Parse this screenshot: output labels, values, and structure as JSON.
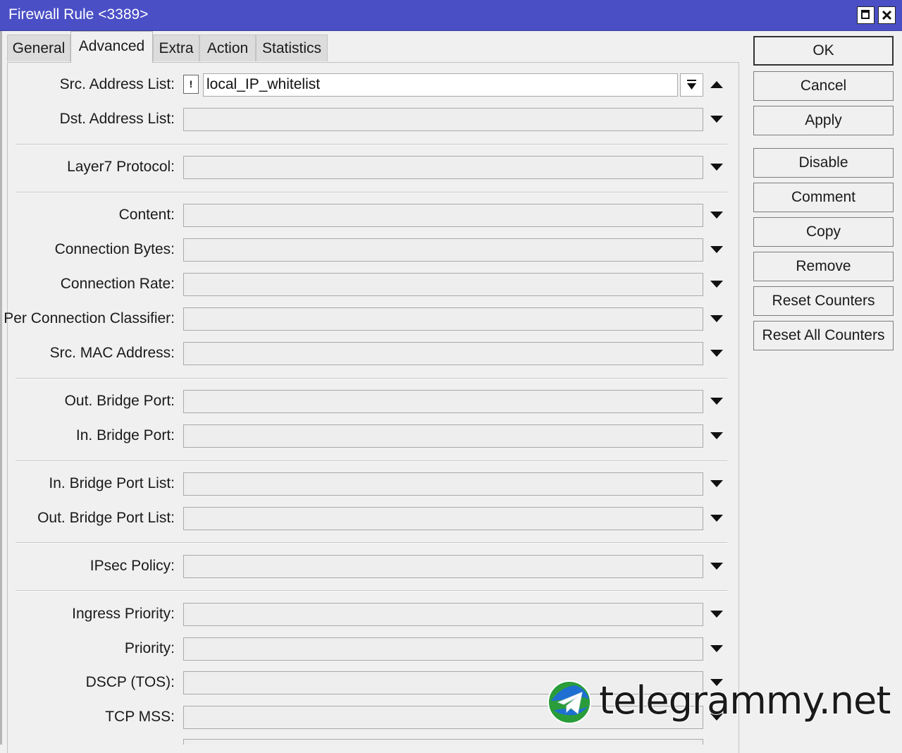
{
  "window": {
    "title": "Firewall Rule <3389>",
    "accent_color": "#4a4fc6",
    "controls": [
      "maximize-icon",
      "close-icon"
    ]
  },
  "tabs": [
    {
      "label": "General",
      "active": false
    },
    {
      "label": "Advanced",
      "active": true
    },
    {
      "label": "Extra",
      "active": false
    },
    {
      "label": "Action",
      "active": false
    },
    {
      "label": "Statistics",
      "active": false
    }
  ],
  "fields": [
    {
      "label": "Src. Address List:",
      "value": "local_IP_whitelist",
      "invert": "!"
    },
    {
      "label": "Dst. Address List:",
      "value": ""
    },
    {
      "label": "Layer7 Protocol:",
      "value": ""
    },
    {
      "label": "Content:",
      "value": ""
    },
    {
      "label": "Connection Bytes:",
      "value": ""
    },
    {
      "label": "Connection Rate:",
      "value": ""
    },
    {
      "label": "Per Connection Classifier:",
      "value": ""
    },
    {
      "label": "Src. MAC Address:",
      "value": ""
    },
    {
      "label": "Out. Bridge Port:",
      "value": ""
    },
    {
      "label": "In. Bridge Port:",
      "value": ""
    },
    {
      "label": "In. Bridge Port List:",
      "value": ""
    },
    {
      "label": "Out. Bridge Port List:",
      "value": ""
    },
    {
      "label": "IPsec Policy:",
      "value": ""
    },
    {
      "label": "Ingress Priority:",
      "value": ""
    },
    {
      "label": "Priority:",
      "value": ""
    },
    {
      "label": "DSCP (TOS):",
      "value": ""
    },
    {
      "label": "TCP MSS:",
      "value": ""
    }
  ],
  "buttons": {
    "ok": "OK",
    "cancel": "Cancel",
    "apply": "Apply",
    "disable": "Disable",
    "comment": "Comment",
    "copy": "Copy",
    "remove": "Remove",
    "reset_counters": "Reset Counters",
    "reset_all_counters": "Reset All Counters"
  },
  "watermark": {
    "text": "telegrammy.net",
    "logo_icon": "telegram-globe-icon"
  }
}
